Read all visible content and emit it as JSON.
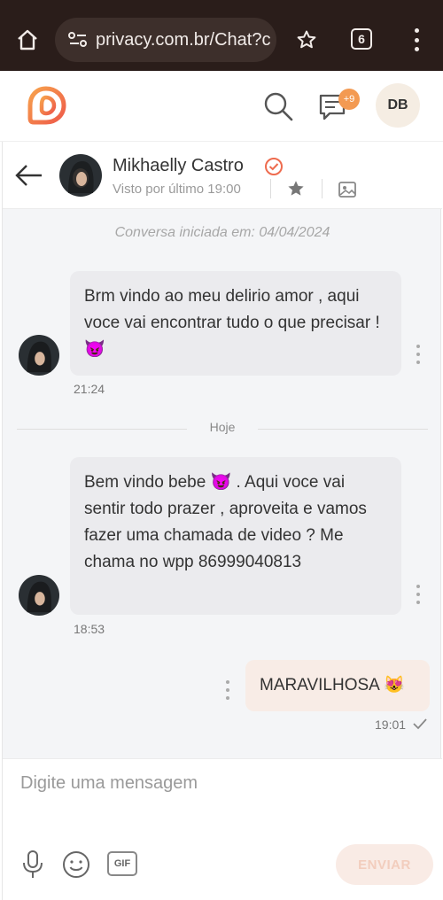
{
  "browser": {
    "url": "privacy.com.br/Chat?c",
    "tab_count": "6"
  },
  "header": {
    "notification_count": "+9",
    "user_initials": "DB"
  },
  "chat": {
    "contact_name": "Mikhaelly Castro",
    "last_seen": "Visto por último 19:00",
    "started": "Conversa iniciada em: 04/04/2024",
    "divider_label": "Hoje",
    "messages": [
      {
        "direction": "in",
        "text": "Brm vindo ao meu delirio amor , aqui voce vai encontrar tudo o que precisar ! 😈",
        "time": "21:24"
      },
      {
        "direction": "in",
        "text": "Bem vindo bebe 😈 . Aqui voce vai sentir todo prazer , aproveita e vamos fazer uma chamada de video ? Me chama no wpp 86999040813",
        "time": "18:53"
      },
      {
        "direction": "out",
        "text": "MARAVILHOSA 😻",
        "time": "19:01"
      }
    ]
  },
  "composer": {
    "placeholder": "Digite uma mensagem",
    "gif_label": "GIF",
    "send_label": "ENVIAR"
  },
  "colors": {
    "brand": "#f39a52",
    "browser_bg": "#2a1d1a",
    "incoming_bubble": "#ebebee",
    "outgoing_bubble": "#f8ece6"
  }
}
